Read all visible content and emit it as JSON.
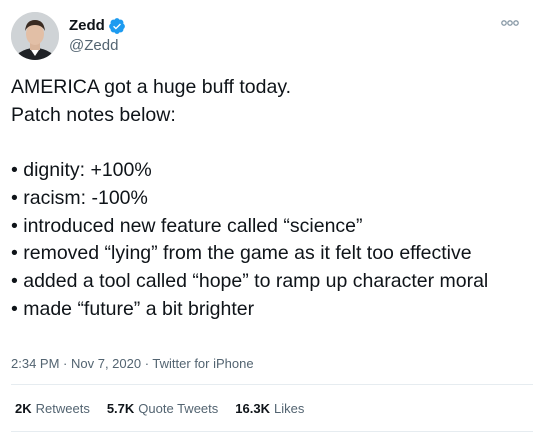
{
  "author": {
    "display_name": "Zedd",
    "handle": "@Zedd",
    "verified": true
  },
  "tweet": {
    "text": "AMERICA got a huge buff today.\nPatch notes below:\n\n• dignity: +100%\n• racism: -100%\n• introduced new feature called “science”\n• removed “lying” from the game as it felt too effective\n• added a tool called “hope” to ramp up character moral\n• made “future” a bit brighter"
  },
  "meta": {
    "time": "2:34 PM",
    "separator1": " · ",
    "date": "Nov 7, 2020",
    "separator2": " · ",
    "source": "Twitter for iPhone"
  },
  "stats": {
    "retweets_count": "2K",
    "retweets_label": "Retweets",
    "quotes_count": "5.7K",
    "quotes_label": "Quote Tweets",
    "likes_count": "16.3K",
    "likes_label": "Likes"
  },
  "colors": {
    "verified_badge": "#1d9bf0",
    "secondary_text": "#536471",
    "primary_text": "#0f1419"
  },
  "icons": {
    "verified": "verified-badge-icon",
    "more": "more-options-icon"
  }
}
